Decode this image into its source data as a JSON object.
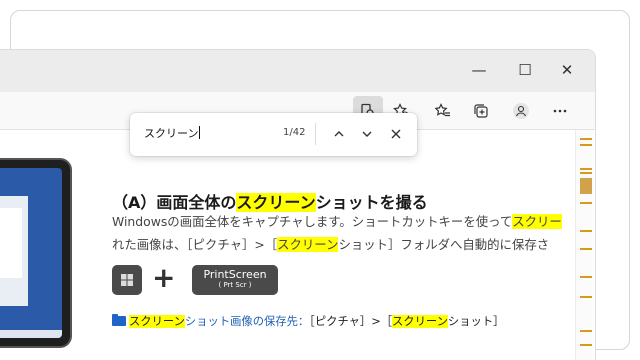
{
  "window": {
    "minimize_glyph": "—",
    "maximize_glyph": "☐",
    "close_glyph": "✕"
  },
  "toolbar": {
    "icons": [
      "page-search-icon",
      "favorite-add-icon",
      "favorites-icon",
      "collections-icon",
      "profile-icon",
      "more-icon"
    ]
  },
  "find": {
    "query": "スクリーン",
    "count": "1/42",
    "prev_glyph": "︿",
    "next_glyph": "﹀",
    "close_glyph": "✕"
  },
  "content": {
    "heading_pre": "（A）画面全体の",
    "heading_hl": "スクリーン",
    "heading_post": "ショットを撮る",
    "para1_pre": "Windowsの画面全体をキャプチャします。ショートカットキーを使って",
    "para1_hl": "スクリー",
    "para2_pre": "れた画像は、［ピクチャ］>［",
    "para2_hl": "スクリーン",
    "para2_post": "ショット］フォルダへ自動的に保存さ",
    "plus": "+",
    "prt_line1": "PrintScreen",
    "prt_line2": "( Prt Scr )",
    "save_hl1": "スクリーン",
    "save_label": "ショット画像の保存先：",
    "save_mid": "［ピクチャ］>［",
    "save_hl2": "スクリーン",
    "save_post": "ショット］"
  },
  "colors": {
    "highlight": "#ffff00",
    "scroll_mark": "#d89a1c",
    "link_blue": "#1f5fb6"
  }
}
